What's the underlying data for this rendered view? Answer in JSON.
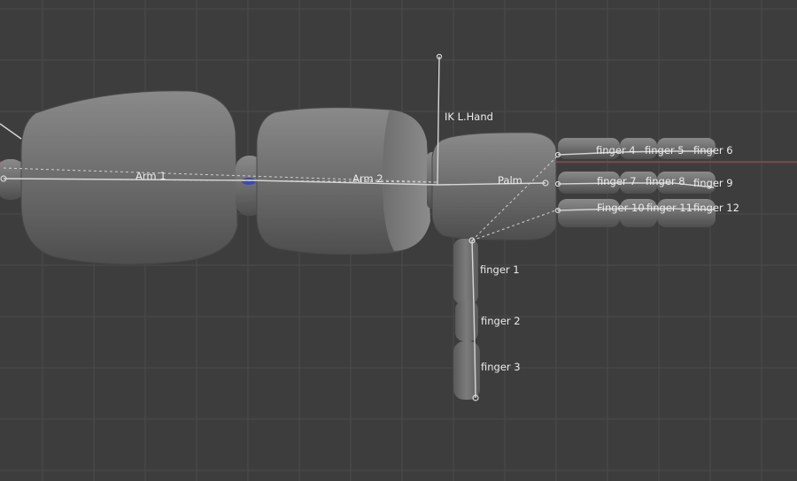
{
  "viewport": {
    "background": "#3d3d3d",
    "grid_color": "#4a4a4a",
    "x_axis_color": "#b8474c",
    "mesh_color": "#777777"
  },
  "bones": [
    {
      "id": "arm-1",
      "label": "Arm 1"
    },
    {
      "id": "arm-2",
      "label": "Arm 2"
    },
    {
      "id": "ik-l-hand",
      "label": "IK L.Hand"
    },
    {
      "id": "palm",
      "label": "Palm"
    },
    {
      "id": "finger-1",
      "label": "finger 1"
    },
    {
      "id": "finger-2",
      "label": "finger 2"
    },
    {
      "id": "finger-3",
      "label": "finger 3"
    },
    {
      "id": "finger-4",
      "label": "finger 4"
    },
    {
      "id": "finger-5",
      "label": "finger 5"
    },
    {
      "id": "finger-6",
      "label": "finger 6"
    },
    {
      "id": "finger-7",
      "label": "finger 7"
    },
    {
      "id": "finger-8",
      "label": "finger 8"
    },
    {
      "id": "finger-9",
      "label": "finger 9"
    },
    {
      "id": "finger-10",
      "label": "Finger 10"
    },
    {
      "id": "finger-11",
      "label": "finger 11"
    },
    {
      "id": "finger-12",
      "label": "finger 12"
    }
  ]
}
